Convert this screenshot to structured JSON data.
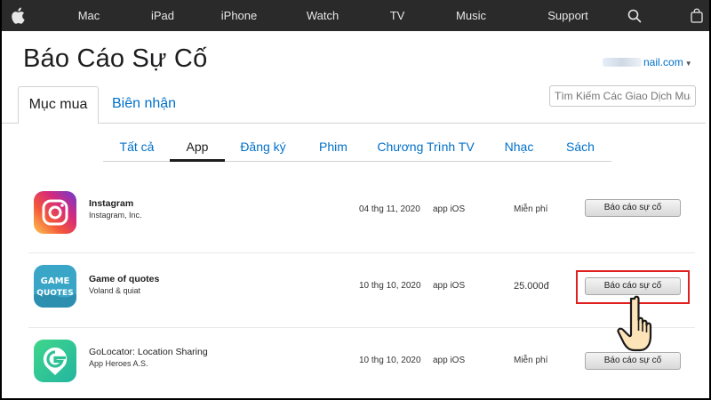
{
  "nav": {
    "items": [
      "Mac",
      "iPad",
      "iPhone",
      "Watch",
      "TV",
      "Music",
      "Support"
    ],
    "icons": [
      "apple-logo-icon",
      "search-icon",
      "bag-icon"
    ]
  },
  "page": {
    "title": "Báo Cáo Sự Cố",
    "account_suffix": "nail.com",
    "search_placeholder": "Tìm Kiếm Các Giao Dịch Mua H"
  },
  "tabs": {
    "purchases": "Mục mua",
    "receipts": "Biên nhận"
  },
  "subtabs": {
    "active_index": 1,
    "items": [
      "Tất cả",
      "App",
      "Đăng ký",
      "Phim",
      "Chương Trình TV",
      "Nhạc",
      "Sách"
    ]
  },
  "purchases": [
    {
      "name": "Instagram",
      "developer": "Instagram, Inc.",
      "date": "04 thg 11, 2020",
      "type": "app iOS",
      "price": "Miễn phí",
      "button": "Báo cáo sự cố",
      "icon": "instagram-icon"
    },
    {
      "name": "Game of quotes",
      "developer": "Voland & quiat",
      "date": "10 thg 10, 2020",
      "type": "app iOS",
      "price": "25.000đ",
      "button": "Báo cáo sự cố",
      "icon": "game-of-quotes-icon",
      "icon_text_top": "GAME",
      "icon_text_bottom": "QUOTES"
    },
    {
      "name": "GoLocator: Location Sharing",
      "developer": "App Heroes A.S.",
      "date": "10 thg 10, 2020",
      "type": "app iOS",
      "price": "Miễn phí",
      "button": "Báo cáo sự cố",
      "icon": "golocator-icon"
    }
  ],
  "colors": {
    "nav_bg": "#2a2a2a",
    "link": "#0070c9",
    "highlight": "#e0201f"
  }
}
